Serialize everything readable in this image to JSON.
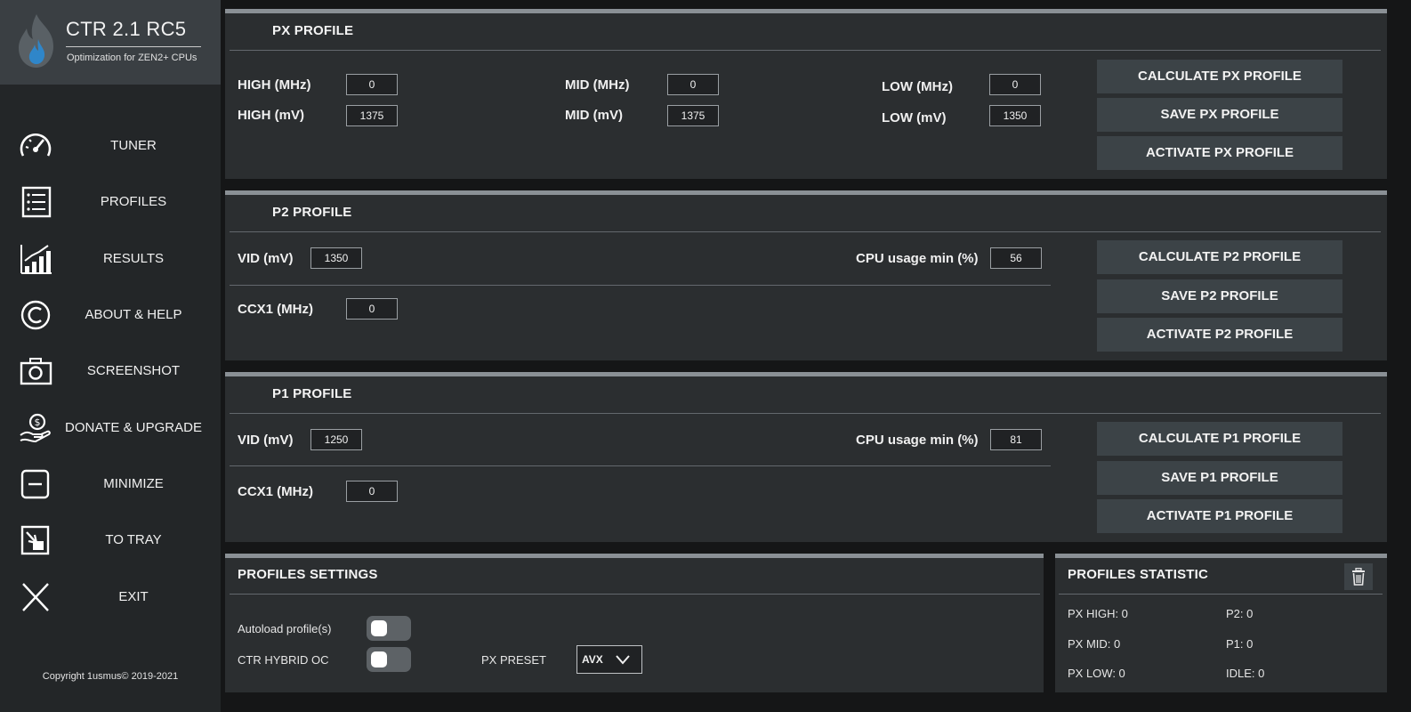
{
  "app": {
    "title": "CTR 2.1 RC5",
    "subtitle": "Optimization for ZEN2+ CPUs",
    "copyright": "Copyright 1usmus© 2019-2021"
  },
  "sidebar": {
    "items": [
      {
        "label": "TUNER",
        "icon": "speedometer-icon"
      },
      {
        "label": "PROFILES",
        "icon": "list-icon"
      },
      {
        "label": "RESULTS",
        "icon": "bar-chart-icon"
      },
      {
        "label": "ABOUT & HELP",
        "icon": "copyright-icon"
      },
      {
        "label": "SCREENSHOT",
        "icon": "camera-icon"
      },
      {
        "label": "DONATE & UPGRADE",
        "icon": "donate-hand-icon"
      },
      {
        "label": "MINIMIZE",
        "icon": "minimize-icon"
      },
      {
        "label": "TO TRAY",
        "icon": "to-tray-icon"
      },
      {
        "label": "EXIT",
        "icon": "close-icon"
      }
    ]
  },
  "px_profile": {
    "title": "PX PROFILE",
    "high_mhz_label": "HIGH (MHz)",
    "high_mhz": "0",
    "high_mv_label": "HIGH  (mV)",
    "high_mv": "1375",
    "mid_mhz_label": "MID (MHz)",
    "mid_mhz": "0",
    "mid_mv_label": "MID (mV)",
    "mid_mv": "1375",
    "low_mhz_label": "LOW (MHz)",
    "low_mhz": "0",
    "low_mv_label": "LOW (mV)",
    "low_mv": "1350",
    "calculate": "CALCULATE PX PROFILE",
    "save": "SAVE PX PROFILE",
    "activate": "ACTIVATE PX PROFILE"
  },
  "p2_profile": {
    "title": "P2 PROFILE",
    "vid_label": "VID (mV)",
    "vid": "1350",
    "cpu_usage_label": "CPU usage min (%)",
    "cpu_usage": "56",
    "ccx1_label": "CCX1 (MHz)",
    "ccx1": "0",
    "calculate": "CALCULATE P2 PROFILE",
    "save": "SAVE P2 PROFILE",
    "activate": "ACTIVATE P2 PROFILE"
  },
  "p1_profile": {
    "title": "P1 PROFILE",
    "vid_label": "VID (mV)",
    "vid": "1250",
    "cpu_usage_label": "CPU usage min (%)",
    "cpu_usage": "81",
    "ccx1_label": "CCX1 (MHz)",
    "ccx1": "0",
    "calculate": "CALCULATE P1 PROFILE",
    "save": "SAVE P1 PROFILE",
    "activate": "ACTIVATE P1 PROFILE"
  },
  "settings": {
    "title": "PROFILES SETTINGS",
    "autoload_label": "Autoload profile(s)",
    "autoload_on": false,
    "hybrid_label": "CTR HYBRID OC",
    "hybrid_on": false,
    "preset_label": "PX PRESET",
    "preset_value": "AVX"
  },
  "statistic": {
    "title": "PROFILES STATISTIC",
    "px_high": "PX HIGH: 0",
    "px_mid": "PX MID: 0",
    "px_low": "PX LOW: 0",
    "p2": "P2: 0",
    "p1": "P1: 0",
    "idle": "IDLE: 0"
  },
  "colors": {
    "panel_bg": "#2b2e30",
    "sidebar_bg": "#232628",
    "button_bg": "#3c4347",
    "panel_border": "#8a9095"
  }
}
